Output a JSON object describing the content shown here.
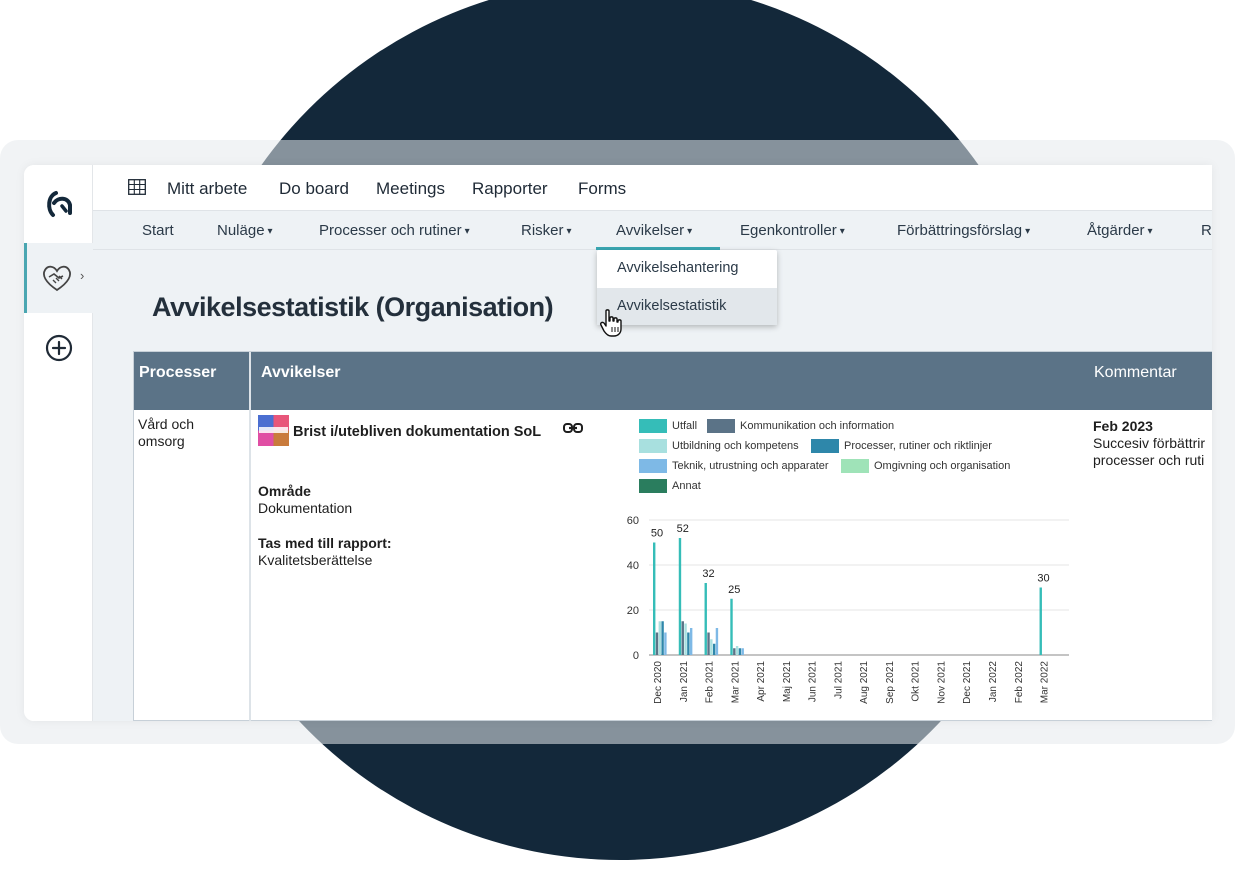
{
  "topnav": {
    "items": [
      "Mitt arbete",
      "Do board",
      "Meetings",
      "Rapporter",
      "Forms"
    ]
  },
  "subnav": {
    "items": [
      {
        "label": "Start",
        "has_dropdown": false
      },
      {
        "label": "Nuläge",
        "has_dropdown": true
      },
      {
        "label": "Processer och rutiner",
        "has_dropdown": true
      },
      {
        "label": "Risker",
        "has_dropdown": true
      },
      {
        "label": "Avvikelser",
        "has_dropdown": true,
        "active": true
      },
      {
        "label": "Egenkontroller",
        "has_dropdown": true
      },
      {
        "label": "Förbättringsförslag",
        "has_dropdown": true
      },
      {
        "label": "Åtgärder",
        "has_dropdown": true
      },
      {
        "label": "R",
        "has_dropdown": false
      }
    ],
    "active_color": "#3aa7b2"
  },
  "dropdown": {
    "items": [
      "Avvikelsehantering",
      "Avvikelsestatistik"
    ],
    "hovered": "Avvikelsestatistik"
  },
  "page": {
    "title": "Avvikelsestatistik (Organisation)"
  },
  "table": {
    "headers": {
      "processer": "Processer",
      "avvikelser": "Avvikelser",
      "kommentar": "Kommentar"
    },
    "row": {
      "process": "Vård och omsorg",
      "avvikelse_title": "Brist i/utebliven dokumentation SoL",
      "omrade_label": "Område",
      "omrade_value": "Dokumentation",
      "rapport_label": "Tas med till rapport:",
      "rapport_value": "Kvalitetsberättelse",
      "comment_date": "Feb 2023",
      "comment_line1": "Succesiv förbättrir",
      "comment_line2": "processer och ruti"
    }
  },
  "icons": {
    "logo": "brand-logo-icon",
    "heart": "handshake-heart-icon",
    "add": "add-circle-icon",
    "grid": "grid-icon",
    "link": "link-icon",
    "cursor": "hand-pointer-icon"
  },
  "colors": {
    "header_bg": "#5b7387",
    "background_circle": "#13283a",
    "accent": "#3aa7b2"
  },
  "chart_data": {
    "type": "bar",
    "categories": [
      "Dec 2020",
      "Jan 2021",
      "Feb 2021",
      "Mar 2021",
      "Apr 2021",
      "Maj 2021",
      "Jun 2021",
      "Jul 2021",
      "Aug 2021",
      "Sep 2021",
      "Okt 2021",
      "Nov 2021",
      "Dec 2021",
      "Jan 2022",
      "Feb 2022",
      "Mar 2022"
    ],
    "ylim": [
      0,
      60
    ],
    "yticks": [
      0,
      20,
      40,
      60
    ],
    "grid": true,
    "legend_position": "top",
    "series": [
      {
        "name": "Utfall",
        "color": "#35bdb8",
        "values": [
          50,
          52,
          32,
          25,
          0,
          0,
          0,
          0,
          0,
          0,
          0,
          0,
          0,
          0,
          0,
          30
        ],
        "labels": [
          50,
          52,
          32,
          25,
          null,
          null,
          null,
          null,
          null,
          null,
          null,
          null,
          null,
          null,
          null,
          30
        ]
      },
      {
        "name": "Kommunikation och information",
        "color": "#5b7387",
        "values": [
          10,
          15,
          10,
          3,
          0,
          0,
          0,
          0,
          0,
          0,
          0,
          0,
          0,
          0,
          0,
          0
        ]
      },
      {
        "name": "Utbildning och kompetens",
        "color": "#a8e0df",
        "values": [
          15,
          14,
          7,
          4,
          0,
          0,
          0,
          0,
          0,
          0,
          0,
          0,
          0,
          0,
          0,
          0
        ]
      },
      {
        "name": "Processer, rutiner och riktlinjer",
        "color": "#2e87aa",
        "values": [
          15,
          10,
          5,
          3,
          0,
          0,
          0,
          0,
          0,
          0,
          0,
          0,
          0,
          0,
          0,
          0
        ]
      },
      {
        "name": "Teknik, utrustning och apparater",
        "color": "#7eb9e6",
        "values": [
          10,
          12,
          12,
          3,
          0,
          0,
          0,
          0,
          0,
          0,
          0,
          0,
          0,
          0,
          0,
          0
        ]
      },
      {
        "name": "Omgivning och organisation",
        "color": "#9fe3b8",
        "values": [
          0,
          0,
          0,
          0,
          0,
          0,
          0,
          0,
          0,
          0,
          0,
          0,
          0,
          0,
          0,
          0
        ]
      },
      {
        "name": "Annat",
        "color": "#2a7d5e",
        "values": [
          0,
          0,
          0,
          0,
          0,
          0,
          0,
          0,
          0,
          0,
          0,
          0,
          0,
          0,
          0,
          0
        ]
      }
    ]
  }
}
